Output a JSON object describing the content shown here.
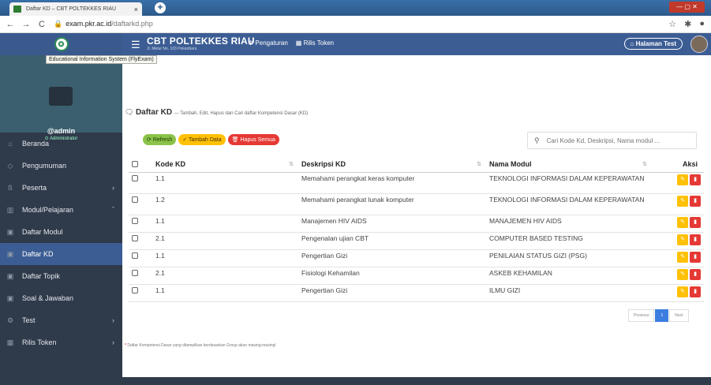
{
  "browser": {
    "tab_title": "Daftar KD – CBT POLTEKKES RIAU",
    "tab_close": "×",
    "new_tab": "+",
    "url_host": "exam.pkr.ac.id",
    "url_path": "/daftarkd.php"
  },
  "header": {
    "title": "CBT POLTEKKES RIAU",
    "subtitle": "Jl. Melur No. 103 Pekanbaru",
    "menu": [
      "Pengaturan",
      "Rilis Token"
    ],
    "halaman": "Halaman Test"
  },
  "tooltip": "Educational Information System (FlyExam)",
  "user": {
    "name": "@admin",
    "role": "Administrator"
  },
  "sidebar": {
    "items": [
      {
        "label": "Beranda",
        "icon": "home-icon"
      },
      {
        "label": "Pengumuman",
        "icon": "megaphone-icon"
      },
      {
        "label": "Peserta",
        "icon": "users-icon",
        "arrow": "›"
      },
      {
        "label": "Modul/Pelajaran",
        "icon": "book-icon",
        "arrow": "ˆ"
      },
      {
        "label": "Daftar Modul",
        "icon": "list-icon"
      },
      {
        "label": "Daftar KD",
        "icon": "list-icon",
        "active": true
      },
      {
        "label": "Daftar Topik",
        "icon": "list-icon"
      },
      {
        "label": "Soal & Jawaban",
        "icon": "list-icon"
      },
      {
        "label": "Test",
        "icon": "gear-icon",
        "arrow": "›"
      },
      {
        "label": "Rilis Token",
        "icon": "grid-icon",
        "arrow": "›"
      }
    ]
  },
  "page": {
    "title": "Daftar KD",
    "desc": "— Tambah, Edit, Hapus dan Cari daftar Kompetensi Dasar (KD)"
  },
  "buttons": {
    "refresh": "Refresh",
    "add": "Tambah Data",
    "delete_all": "Hapus Semua"
  },
  "search": {
    "placeholder": "Cari Kode Kd, Deskripsi, Nama modul ..."
  },
  "table": {
    "headers": [
      "Kode KD",
      "Deskripsi KD",
      "Nama Modul",
      "Aksi"
    ],
    "rows": [
      {
        "kode": "1.1",
        "desk": "Memahami perangkat keras komputer",
        "modul": "TEKNOLOGI INFORMASI DALAM KEPERAWATAN"
      },
      {
        "kode": "1.2",
        "desk": "Memahami perangkat lunak komputer",
        "modul": "TEKNOLOGI INFORMASI DALAM KEPERAWATAN"
      },
      {
        "kode": "1.1",
        "desk": "Manajemen HIV AIDS",
        "modul": "MANAJEMEN HIV AIDS"
      },
      {
        "kode": "2.1",
        "desk": "Pengenalan ujian CBT",
        "modul": "COMPUTER BASED TESTING"
      },
      {
        "kode": "1.1",
        "desk": "Pengertian Gizi",
        "modul": "PENILAIAN STATUS GIZI (PSG)"
      },
      {
        "kode": "2.1",
        "desk": "Fisiologi Kehamilan",
        "modul": "ASKEB KEHAMILAN"
      },
      {
        "kode": "1.1",
        "desk": "Pengertian Gizi",
        "modul": "ILMU GIZI"
      }
    ]
  },
  "pager": {
    "prev": "Previous",
    "page": "1",
    "next": "Next"
  },
  "note": "Daftar Kompetensi Dasar yang ditampilkan berdasarkan Group akun masing-masing!",
  "colors": {
    "nav": "#3c5d94",
    "sidebar": "#2f3a4a",
    "edit": "#ffc107",
    "delete": "#e53935",
    "refresh": "#8bc34a"
  }
}
